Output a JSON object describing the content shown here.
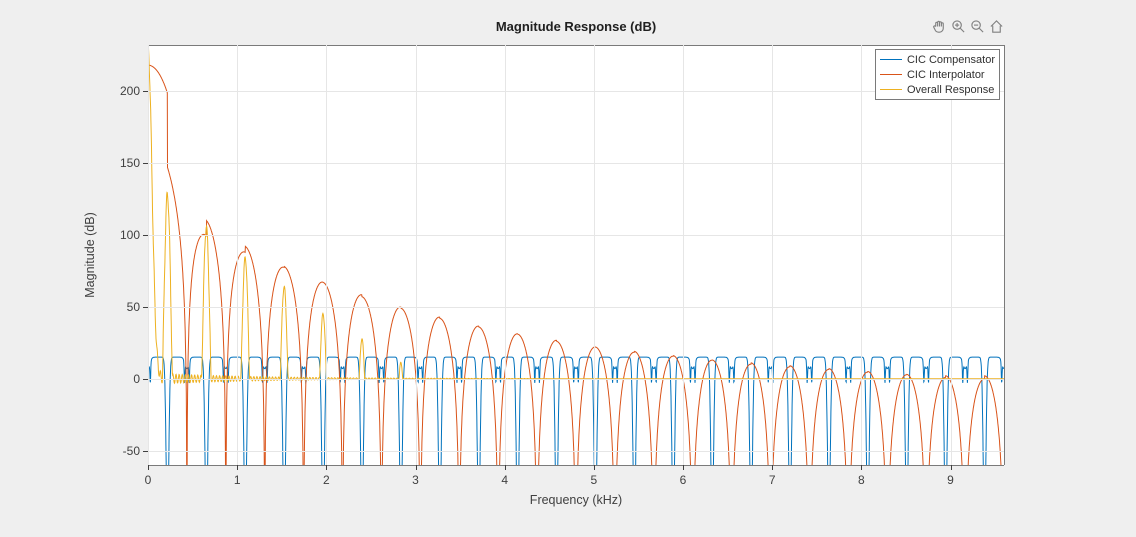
{
  "chart_data": {
    "type": "line",
    "title": "Magnitude Response (dB)",
    "xlabel": "Frequency (kHz)",
    "ylabel": "Magnitude (dB)",
    "x_ticks": [
      0,
      1,
      2,
      3,
      4,
      5,
      6,
      7,
      8,
      9
    ],
    "y_ticks": [
      -50,
      0,
      50,
      100,
      150,
      200
    ],
    "xlim": [
      0,
      9.6
    ],
    "ylim": [
      -60,
      232
    ],
    "legend_position": "upper right",
    "series": [
      {
        "name": "CIC Compensator",
        "color": "#0072BD",
        "description": "Periodic pattern repeating every ~0.438 kHz: mostly flat near +15 dB with a narrow deep null (< -60 dB) near the center of each period and two small notches at the transition edges. Pattern is identical across the whole frequency range."
      },
      {
        "name": "CIC Interpolator",
        "color": "#D95319",
        "description": "CIC sinc-power magnitude. Starts at ~218 dB near DC, nulls (< -60 dB) near each multiple of ~0.438 kHz, lobe peaks decaying toward ~2 dB at the highest frequencies.",
        "lobe_centers_kHz": [
          0.219,
          0.656,
          1.094,
          1.531,
          1.969,
          2.406,
          2.844,
          3.281,
          3.719,
          4.156,
          4.594,
          5.031,
          5.469,
          5.906,
          6.344,
          6.781,
          7.219,
          7.656,
          8.094,
          8.531,
          8.969,
          9.406
        ],
        "lobe_peak_dB": [
          218,
          147,
          110,
          92,
          78,
          67,
          57,
          49,
          42,
          36,
          31,
          26,
          22,
          19,
          16,
          13,
          11,
          9,
          7,
          5,
          3,
          2
        ]
      },
      {
        "name": "Overall Response",
        "color": "#EDB120",
        "description": "Product of the above. Main-lobe peak ~230 dB near DC with much narrower support (rises/falls sharply), then a forest of side lobes whose envelope decays below -60 dB by about 5.5 kHz. Between ~5.5 and 9.6 kHz the visible response reappears as narrow images (period ~0.438 kHz) roughly between -5 and 0 dB."
      }
    ]
  },
  "toolbar": {
    "icons": [
      "Pan",
      "Zoom In",
      "Zoom Out",
      "Home"
    ]
  }
}
